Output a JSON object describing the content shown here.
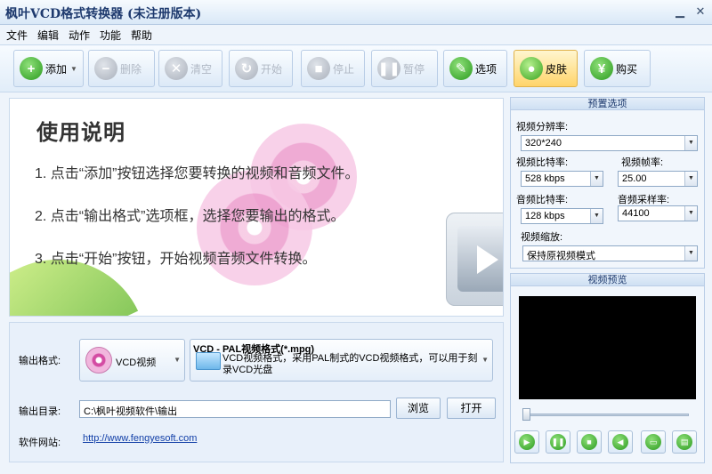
{
  "window": {
    "title": "枫叶VCD格式转换器  (未注册版本)"
  },
  "menu": [
    "文件",
    "编辑",
    "动作",
    "功能",
    "帮助"
  ],
  "toolbar": {
    "add": "添加",
    "delete": "删除",
    "clear": "清空",
    "start": "开始",
    "stop": "停止",
    "pause": "暂停",
    "options": "选项",
    "skin": "皮肤",
    "buy": "购买"
  },
  "usage": {
    "heading": "使用说明",
    "steps": [
      "1. 点击“添加”按钮选择您要转换的视频和音频文件。",
      "2. 点击“输出格式”选项框，选择您要输出的格式。",
      "3. 点击“开始”按钮，开始视频音频文件转换。"
    ]
  },
  "output": {
    "format_label": "输出格式:",
    "format_category": "VCD视频",
    "format_title": "VCD - PAL视频格式(*.mpg)",
    "format_desc": "VCD视频格式，采用PAL制式的VCD视频格式，可以用于刻录VCD光盘",
    "dir_label": "输出目录:",
    "dir_value": "C:\\枫叶视频软件\\输出",
    "browse": "浏览",
    "open": "打开",
    "site_label": "软件网站:",
    "site_url": "http://www.fengyesoft.com"
  },
  "preset": {
    "title": "预置选项",
    "resolution_label": "视频分辨率:",
    "resolution_value": "320*240",
    "video_bitrate_label": "视频比特率:",
    "video_bitrate_value": "528 kbps",
    "framerate_label": "视频帧率:",
    "framerate_value": "25.00",
    "audio_bitrate_label": "音频比特率:",
    "audio_bitrate_value": "128 kbps",
    "samplerate_label": "音频采样率:",
    "samplerate_value": "44100",
    "scale_label": "视频缩放:",
    "scale_value": "保持原视频模式"
  },
  "preview": {
    "title": "视频预览"
  },
  "colors": {
    "accent": "#2a9a1e",
    "skin_button": "#ffd46a"
  }
}
